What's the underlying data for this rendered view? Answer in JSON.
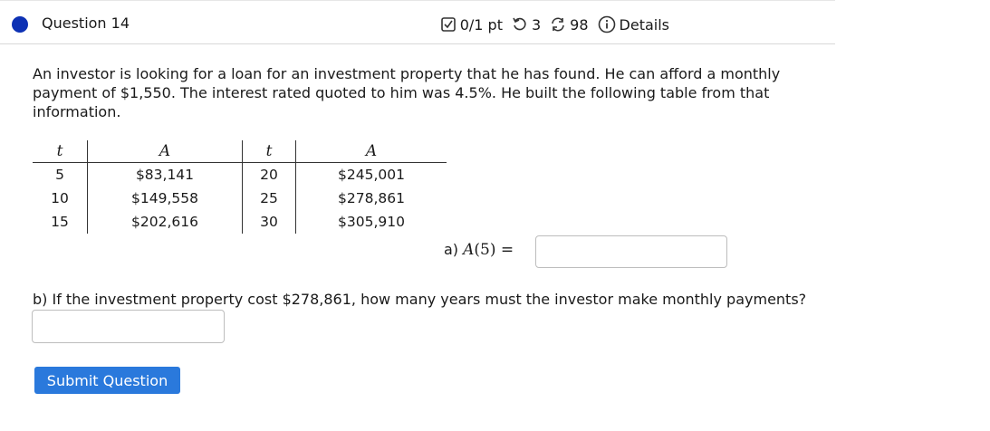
{
  "question": {
    "title": "Question 14",
    "score": "0/1 pt",
    "retries": "3",
    "attempts": "98",
    "details_label": "Details"
  },
  "prompt": "An investor is looking for a loan for an investment property that he has found. He can afford a monthly payment of $1,550. The interest rated quoted to him was 4.5%. He built the following table from that information.",
  "table": {
    "headers": [
      "t",
      "A",
      "t",
      "A"
    ],
    "rows": [
      [
        "5",
        "$83,141",
        "20",
        "$245,001"
      ],
      [
        "10",
        "$149,558",
        "25",
        "$278,861"
      ],
      [
        "15",
        "$202,616",
        "30",
        "$305,910"
      ]
    ]
  },
  "part_a": {
    "prefix": "a)",
    "func": "A",
    "arg": "(5)",
    "equals": "=",
    "value": ""
  },
  "part_b": {
    "text": "b) If the investment property cost $278,861, how many years must the investor make monthly payments?",
    "value": ""
  },
  "submit_label": "Submit Question",
  "colors": {
    "dot": "#0d31b4",
    "button": "#2a79dc"
  }
}
